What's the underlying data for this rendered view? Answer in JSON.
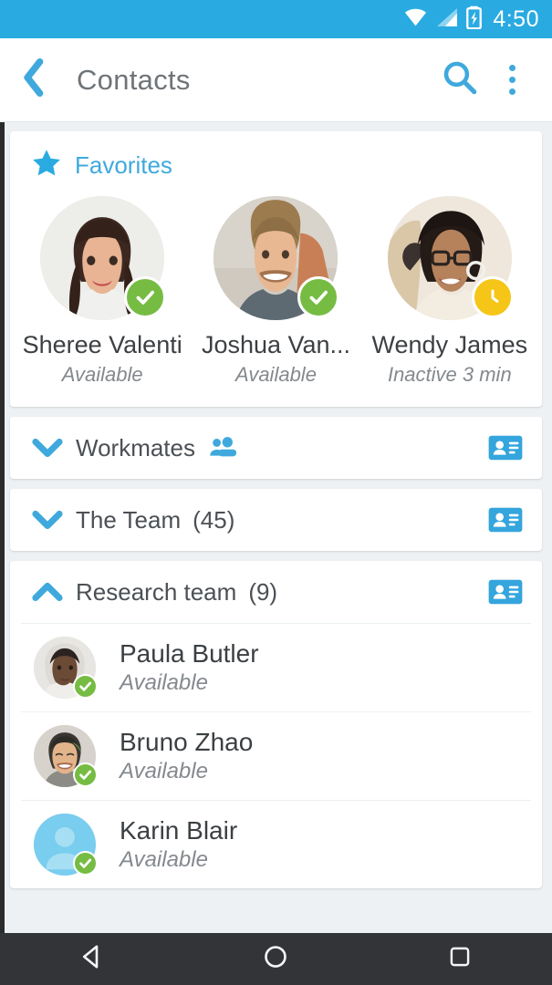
{
  "status_bar": {
    "time": "4:50",
    "icons": [
      "wifi-icon",
      "cell-signal-icon",
      "battery-charging-icon"
    ]
  },
  "app_bar": {
    "title": "Contacts",
    "back_icon": "back-chevron-icon",
    "search_icon": "search-icon",
    "overflow_icon": "overflow-menu-icon"
  },
  "favorites": {
    "label": "Favorites",
    "star_icon": "star-icon",
    "people": [
      {
        "name": "Sheree Valenti",
        "status": "Available",
        "presence": "available"
      },
      {
        "name": "Joshua Van...",
        "status": "Available",
        "presence": "available"
      },
      {
        "name": "Wendy James",
        "status": "Inactive 3 min",
        "presence": "away"
      }
    ]
  },
  "groups": [
    {
      "title": "Workmates",
      "count": "",
      "expanded": false,
      "has_people_icon": true,
      "card_icon": "contact-card-icon"
    },
    {
      "title": "The Team",
      "count": "(45)",
      "expanded": false,
      "has_people_icon": false,
      "card_icon": "contact-card-icon"
    },
    {
      "title": "Research team",
      "count": "(9)",
      "expanded": true,
      "has_people_icon": false,
      "card_icon": "contact-card-icon"
    }
  ],
  "contacts": [
    {
      "name": "Paula Butler",
      "status": "Available",
      "presence": "available",
      "avatar": "photo"
    },
    {
      "name": "Bruno Zhao",
      "status": "Available",
      "presence": "available",
      "avatar": "photo"
    },
    {
      "name": "Karin Blair",
      "status": "Available",
      "presence": "available",
      "avatar": "placeholder"
    }
  ],
  "nav_bar": {
    "back": "nav-back-icon",
    "home": "nav-home-icon",
    "recents": "nav-recents-icon"
  },
  "colors": {
    "accent": "#29abe2",
    "accent_light": "#3fa9dd",
    "available": "#76bc43",
    "away": "#f5c518",
    "background": "#eef1f4",
    "card": "#ffffff"
  }
}
